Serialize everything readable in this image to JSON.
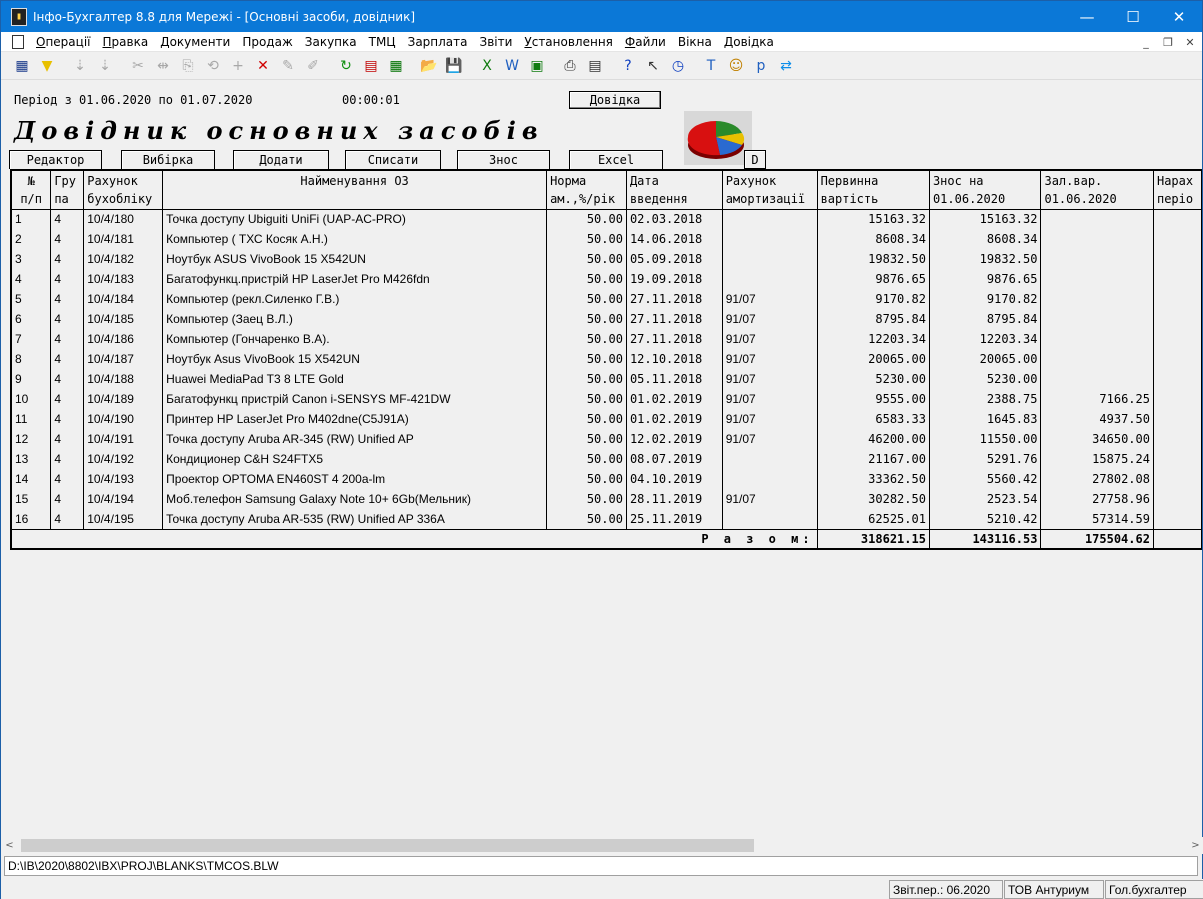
{
  "window": {
    "title": "Інфо-Бухгалтер 8.8 для Мережі - [Основні засоби, довідник]",
    "app_icon": "info-buh-icon",
    "minimize": "—",
    "maximize": "☐",
    "close": "✕"
  },
  "menu": {
    "items": [
      {
        "label": "Операції",
        "ul": "О",
        "rest": "перації"
      },
      {
        "label": "Правка",
        "ul": "П",
        "rest": "равка"
      },
      {
        "label": "Документи",
        "ul": "Д",
        "rest": "окументи"
      },
      {
        "label": "Продаж",
        "ul": "",
        "rest": "Продаж"
      },
      {
        "label": "Закупка",
        "ul": "",
        "rest": "Закупка"
      },
      {
        "label": "ТМЦ",
        "ul": "",
        "rest": "ТМЦ"
      },
      {
        "label": "Зарплата",
        "ul": "",
        "rest": "Зарплата"
      },
      {
        "label": "Звіти",
        "ul": "",
        "rest": "Звіти"
      },
      {
        "label": "Установлення",
        "ul": "У",
        "rest": "становлення"
      },
      {
        "label": "Файли",
        "ul": "Ф",
        "rest": "айли"
      },
      {
        "label": "Вікна",
        "ul": "",
        "rest": "Вікна"
      },
      {
        "label": "Довідка",
        "ul": "Д",
        "rest": "овідка"
      }
    ],
    "mdi_min": "_",
    "mdi_restore": "❐",
    "mdi_close": "✕"
  },
  "toolbar": [
    {
      "icon": "grid-view-icon",
      "glyph": "▦",
      "enabled": true,
      "color": "#1a3a8a"
    },
    {
      "icon": "filter-icon",
      "glyph": "▼",
      "enabled": true,
      "color": "#e8c000"
    },
    {
      "sep": true
    },
    {
      "icon": "sort-asc-icon",
      "glyph": "⇣",
      "enabled": false
    },
    {
      "icon": "sort-desc-icon",
      "glyph": "⇣",
      "enabled": false
    },
    {
      "sep": true
    },
    {
      "icon": "scissors-icon",
      "glyph": "✂",
      "enabled": false
    },
    {
      "icon": "split-icon",
      "glyph": "⇹",
      "enabled": false
    },
    {
      "icon": "copy-icon",
      "glyph": "⎘",
      "enabled": false
    },
    {
      "icon": "rotate-180-icon",
      "glyph": "⟲",
      "enabled": false
    },
    {
      "icon": "add-icon",
      "glyph": "+",
      "enabled": false
    },
    {
      "icon": "delete-icon",
      "glyph": "✕",
      "enabled": true,
      "color": "#d00000"
    },
    {
      "icon": "edit-pen-icon",
      "glyph": "✎",
      "enabled": false
    },
    {
      "icon": "stamp-icon",
      "glyph": "✐",
      "enabled": false
    },
    {
      "sep": true
    },
    {
      "icon": "refresh-icon",
      "glyph": "↻",
      "enabled": true,
      "color": "#109010"
    },
    {
      "icon": "pdf-icon",
      "glyph": "▤",
      "enabled": true,
      "color": "#c00000"
    },
    {
      "icon": "calculator-icon",
      "glyph": "▦",
      "enabled": true,
      "color": "#007000"
    },
    {
      "sep": true
    },
    {
      "icon": "open-folder-icon",
      "glyph": "📂",
      "enabled": true,
      "color": "#d0a000"
    },
    {
      "icon": "save-icon",
      "glyph": "💾",
      "enabled": true,
      "color": "#1040a0"
    },
    {
      "sep": true
    },
    {
      "icon": "excel-icon",
      "glyph": "X",
      "enabled": true,
      "color": "#107c10"
    },
    {
      "icon": "word-icon",
      "glyph": "W",
      "enabled": true,
      "color": "#2060c0"
    },
    {
      "icon": "export-icon",
      "glyph": "▣",
      "enabled": true,
      "color": "#107c10"
    },
    {
      "sep": true
    },
    {
      "icon": "print-icon",
      "glyph": "⎙",
      "enabled": true,
      "color": "#333333"
    },
    {
      "icon": "preview-icon",
      "glyph": "▤",
      "enabled": true,
      "color": "#333333"
    },
    {
      "sep": true
    },
    {
      "icon": "help-icon",
      "glyph": "?",
      "enabled": true,
      "color": "#1040c0"
    },
    {
      "icon": "context-help-icon",
      "glyph": "↖",
      "enabled": true,
      "color": "#333333"
    },
    {
      "icon": "compass-icon",
      "glyph": "◷",
      "enabled": true,
      "color": "#1040c0"
    },
    {
      "sep": true
    },
    {
      "icon": "text-tool-icon",
      "glyph": "T",
      "enabled": true,
      "color": "#2060c0"
    },
    {
      "icon": "users-icon",
      "glyph": "☺",
      "enabled": true,
      "color": "#c08000"
    },
    {
      "icon": "document-p-icon",
      "glyph": "p",
      "enabled": true,
      "color": "#2060c0"
    },
    {
      "icon": "teamviewer-icon",
      "glyph": "⇄",
      "enabled": true,
      "color": "#0e8ee9"
    }
  ],
  "header": {
    "period": "Період з 01.06.2020 по 01.07.2020",
    "clock": "00:00:01",
    "help_button": "Довідка",
    "doc_title": "Довідник основних засобів"
  },
  "tabs": [
    {
      "label": "Редактор"
    },
    {
      "label": "Вибірка"
    },
    {
      "label": "Додати"
    },
    {
      "label": "Списати"
    },
    {
      "label": "Знос"
    },
    {
      "label": "Excel"
    },
    {
      "label": "D"
    }
  ],
  "table": {
    "headers_row1": [
      "№",
      "Гру",
      "Рахунок",
      "Найменування ОЗ",
      "Норма",
      "Дата",
      "Рахунок",
      "Первинна",
      "Знос на",
      "Зал.вар.",
      "Нарах"
    ],
    "headers_row2": [
      "п/п",
      "па",
      "бухобліку",
      "",
      "ам.,%/рік",
      "введення",
      "амортизації",
      "вартість",
      "01.06.2020",
      "01.06.2020",
      "періо"
    ],
    "rows": [
      [
        "1",
        "4",
        "10/4/180",
        "Точка доступу Ubiguiti UniFi (UAP-AC-PRO)",
        "50.00",
        "02.03.2018",
        "",
        "15163.32",
        "15163.32",
        "",
        ""
      ],
      [
        "2",
        "4",
        "10/4/181",
        "Компьютер ( ТХС Косяк А.Н.)",
        "50.00",
        "14.06.2018",
        "",
        "8608.34",
        "8608.34",
        "",
        ""
      ],
      [
        "3",
        "4",
        "10/4/182",
        "Ноутбук ASUS VivoBook 15 X542UN",
        "50.00",
        "05.09.2018",
        "",
        "19832.50",
        "19832.50",
        "",
        ""
      ],
      [
        "4",
        "4",
        "10/4/183",
        "Багатофункц.пристрій HP LaserJet Pro M426fdn",
        "50.00",
        "19.09.2018",
        "",
        "9876.65",
        "9876.65",
        "",
        ""
      ],
      [
        "5",
        "4",
        "10/4/184",
        "Компьютер (рекл.Силенко Г.В.)",
        "50.00",
        "27.11.2018",
        "91/07",
        "9170.82",
        "9170.82",
        "",
        ""
      ],
      [
        "6",
        "4",
        "10/4/185",
        "Компьютер (Заец В.Л.)",
        "50.00",
        "27.11.2018",
        "91/07",
        "8795.84",
        "8795.84",
        "",
        ""
      ],
      [
        "7",
        "4",
        "10/4/186",
        "Компьютер (Гончаренко В.А).",
        "50.00",
        "27.11.2018",
        "91/07",
        "12203.34",
        "12203.34",
        "",
        ""
      ],
      [
        "8",
        "4",
        "10/4/187",
        "Ноутбук Asus VivoBook 15 X542UN",
        "50.00",
        "12.10.2018",
        "91/07",
        "20065.00",
        "20065.00",
        "",
        ""
      ],
      [
        "9",
        "4",
        "10/4/188",
        "Huawei MediaPad T3 8 LTE Gold",
        "50.00",
        "05.11.2018",
        "91/07",
        "5230.00",
        "5230.00",
        "",
        ""
      ],
      [
        "10",
        "4",
        "10/4/189",
        "Багатофункц пристрій Canon i-SENSYS MF-421DW",
        "50.00",
        "01.02.2019",
        "91/07",
        "9555.00",
        "2388.75",
        "7166.25",
        ""
      ],
      [
        "11",
        "4",
        "10/4/190",
        "Принтер HP LaserJet Pro M402dne(C5J91A)",
        "50.00",
        "01.02.2019",
        "91/07",
        "6583.33",
        "1645.83",
        "4937.50",
        ""
      ],
      [
        "12",
        "4",
        "10/4/191",
        "Точка доступу Aruba AR-345 (RW) Unified AP",
        "50.00",
        "12.02.2019",
        "91/07",
        "46200.00",
        "11550.00",
        "34650.00",
        ""
      ],
      [
        "13",
        "4",
        "10/4/192",
        "Кондиционер C&H S24FTX5",
        "50.00",
        "08.07.2019",
        "",
        "21167.00",
        "5291.76",
        "15875.24",
        ""
      ],
      [
        "14",
        "4",
        "10/4/193",
        "Проектор OPTOMA EN460ST 4 200a-lm",
        "50.00",
        "04.10.2019",
        "",
        "33362.50",
        "5560.42",
        "27802.08",
        ""
      ],
      [
        "15",
        "4",
        "10/4/194",
        "Моб.телефон Samsung Galaxy Note 10+ 6Gb(Мельник)",
        "50.00",
        "28.11.2019",
        "91/07",
        "30282.50",
        "2523.54",
        "27758.96",
        ""
      ],
      [
        "16",
        "4",
        "10/4/195",
        "Точка доступу Aruba AR-535 (RW) Unified AP 336A",
        "50.00",
        "25.11.2019",
        "",
        "62525.01",
        "5210.42",
        "57314.59",
        ""
      ]
    ],
    "total_label": "Р а з о м:",
    "totals": {
      "initial": "318621.15",
      "wear": "143116.53",
      "residual": "175504.62"
    }
  },
  "scroll": {
    "left": "<",
    "right": ">"
  },
  "path": "D:\\IB\\2020\\8802\\IBX\\PROJ\\BLANKS\\TMCOS.BLW",
  "status": {
    "period": "Звіт.пер.: 06.2020",
    "company": "ТОВ Антуриум",
    "user": "Гол.бухгалтер"
  }
}
